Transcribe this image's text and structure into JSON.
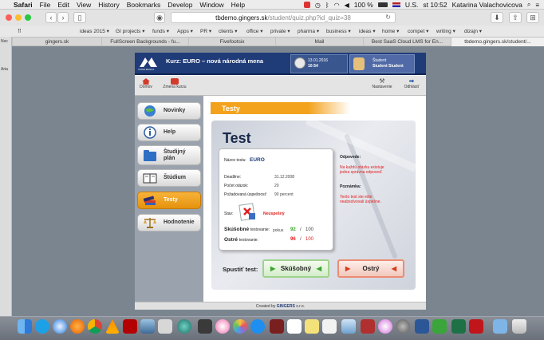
{
  "menubar": {
    "items": [
      "Safari",
      "File",
      "Edit",
      "View",
      "History",
      "Bookmarks",
      "Develop",
      "Window",
      "Help"
    ],
    "battery": "100 %",
    "input_source": "U.S.",
    "clock": "st 10:52",
    "user": "Katarina Valachovicova"
  },
  "browser": {
    "url_host": "tbdemo.gingers.sk",
    "url_path": "/student/quiz.php?id_quiz=38",
    "bookmarks": [
      "ideas 2015 ▾",
      "GI projects ▾",
      "funds ▾",
      "Apps ▾",
      "PR ▾",
      "clients ▾",
      "office ▾",
      "private ▾",
      "pharma ▾",
      "business ▾",
      "ideas ▾",
      "home ▾",
      "compet ▾",
      "writing ▾",
      "dizajn ▾"
    ],
    "tabs": [
      "gingers.sk",
      "FullScreen Backgrounds - fu...",
      "Fivefootsix",
      "Mail",
      "Best SaaS Cloud LMS for En...",
      "tbdemo.gingers.sk/student/..."
    ],
    "left_strip_labels": [
      "Noc",
      "Aria"
    ]
  },
  "site": {
    "course_title": "Kurz: EURO – nová národná mena",
    "logo_text": "TATRA BANKA",
    "date": "13.01.2016",
    "time": "10:54",
    "user_label": "Študent",
    "user_name": "Student Student",
    "nav": {
      "home": "Domov",
      "change_course": "Zmena kurzu",
      "settings": "Nastavenie",
      "logout": "Odhlásiť"
    },
    "menu": [
      {
        "label": "Novinky",
        "icon": "globe-icon"
      },
      {
        "label": "Help",
        "icon": "info-icon"
      },
      {
        "label": "Študijný plán",
        "icon": "folder-icon"
      },
      {
        "label": "Štúdium",
        "icon": "book-icon"
      },
      {
        "label": "Testy",
        "icon": "books-icon",
        "active": true
      },
      {
        "label": "Hodnotenie",
        "icon": "scale-icon"
      }
    ],
    "section_title": "Testy",
    "test_title": "Test",
    "test": {
      "name_label": "Názov testu:",
      "name_value": "EURO",
      "deadline_label": "Deadline:",
      "deadline_value": "31.12.2008",
      "questions_label": "Počet otázok:",
      "questions_value": "20",
      "required_label": "Požadovaná úspešnosť:",
      "required_value": "90 percent",
      "status_label": "Stav:",
      "status_value": "Neúspešný",
      "practice_label": "Skúšobné",
      "testing_word": "testovanie:",
      "attempts_word": "pokus",
      "practice_used": "92",
      "practice_slash": "/",
      "practice_total": "100",
      "sharp_label": "Ostré",
      "sharp_used": "96",
      "sharp_slash": "/",
      "sharp_total": "100"
    },
    "answers_title": "Odpovede:",
    "answers_text": "Na každú otázku existuje jedna správna odpoveď.",
    "note_title": "Poznámka:",
    "note_text": "Tento test ste ešte neabsolvovali úspešne.",
    "start_label": "Spustiť test:",
    "practice_button": "Skúšobný",
    "sharp_button": "Ostrý",
    "footer_prefix": "Created by",
    "footer_brand": "GINGERS",
    "footer_suffix": "s.r.o."
  },
  "colors": {
    "header_blue": "#1f3b78",
    "accent_orange": "#f3a21d",
    "fail_red": "#e02020",
    "practice_green": "#3aa52b",
    "sharp_red": "#d83a20"
  }
}
